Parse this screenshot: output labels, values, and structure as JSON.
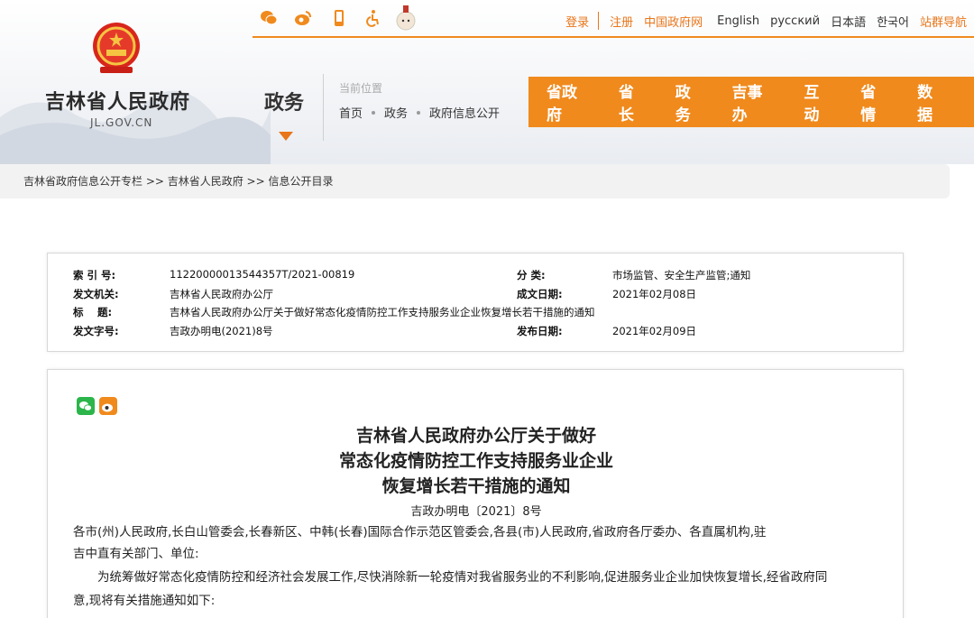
{
  "site": {
    "name": "吉林省人民政府",
    "domain": "JL.GOV.CN"
  },
  "column": {
    "title": "政务",
    "current_position_label": "当前位置",
    "crumbs": [
      "首页",
      "政务",
      "政府信息公开"
    ]
  },
  "top_links": {
    "login": "登录",
    "register": "注册",
    "china_gov": "中国政府网",
    "english": "English",
    "russian": "русский",
    "japanese": "日本語",
    "korean": "한국어",
    "site_nav": "站群导航"
  },
  "share_icons": [
    "wechat-icon",
    "weibo-icon",
    "mobile-icon",
    "accessibility-icon",
    "mascot-icon"
  ],
  "main_nav": [
    "省政府",
    "省长",
    "政务",
    "吉事办",
    "互动",
    "省情",
    "数据"
  ],
  "breadcrumb": "吉林省政府信息公开专栏 >> 吉林省人民政府 >> 信息公开目录",
  "info": {
    "index_label": "索 引 号:",
    "index_value": "11220000013544357T/2021-00819",
    "category_label": "分 类:",
    "category_value": "市场监管、安全生产监管;通知",
    "issuer_label": "发文机关:",
    "issuer_value": "吉林省人民政府办公厅",
    "written_label": "成文日期:",
    "written_value": "2021年02月08日",
    "title_label": "标　 题:",
    "title_value": "吉林省人民政府办公厅关于做好常态化疫情防控工作支持服务业企业恢复增长若干措施的通知",
    "doc_label": "发文字号:",
    "doc_value": "吉政办明电(2021)8号",
    "publish_label": "发布日期:",
    "publish_value": "2021年02月09日"
  },
  "article": {
    "title_line1": "吉林省人民政府办公厅关于做好",
    "title_line2": "常态化疫情防控工作支持服务业企业",
    "title_line3": "恢复增长若干措施的通知",
    "doc_number": "吉政办明电〔2021〕8号",
    "recipients_line1": "各市(州)人民政府,长白山管委会,长春新区、中韩(长春)国际合作示范区管委会,各县(市)人民政府,省政府各厅委办、各直属机构,驻",
    "recipients_line2": "吉中直有关部门、单位:",
    "body_line1": "　　为统筹做好常态化疫情防控和经济社会发展工作,尽快消除新一轮疫情对我省服务业的不利影响,促进服务业企业加快恢复增长,经省政府同",
    "body_line2": "意,现将有关措施通知如下:"
  },
  "colors": {
    "brand_orange": "#f08a1d",
    "wechat_green": "#2bb54a"
  }
}
